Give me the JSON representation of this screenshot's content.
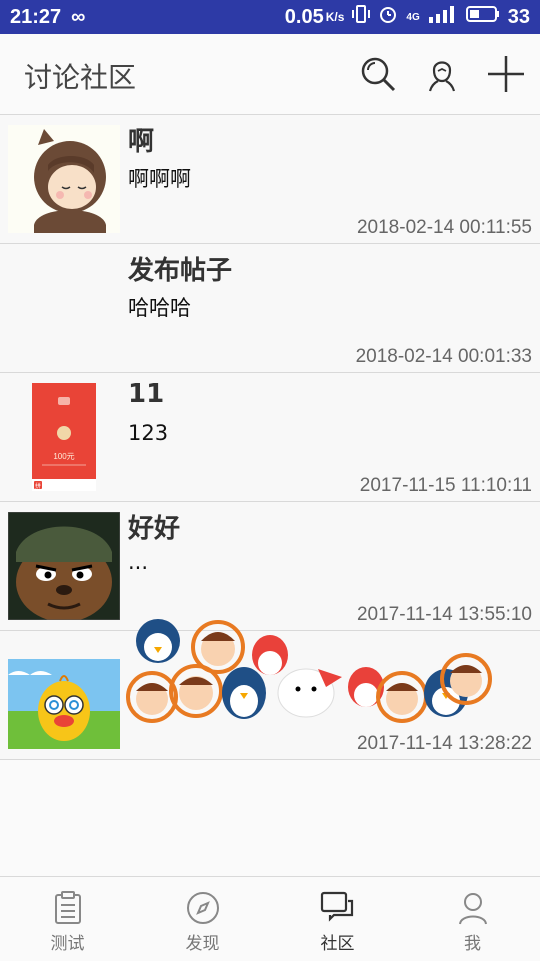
{
  "status_bar": {
    "time": "21:27",
    "infinity_icon": "∞",
    "speed": "0.05",
    "speed_unit": "K/s",
    "network": "4G",
    "battery": "33"
  },
  "header": {
    "title": "讨论社区",
    "icons": [
      "search-icon",
      "user-icon",
      "add-icon"
    ]
  },
  "posts": [
    {
      "title": "啊",
      "body": "啊啊啊",
      "time": "2018-02-14 00:11:55",
      "image": "cartoon-girl-avatar"
    },
    {
      "title": "发布帖子",
      "body": "哈哈哈",
      "time": "2018-02-14 00:01:33",
      "image": ""
    },
    {
      "title": "11",
      "body": "123",
      "time": "2017-11-15 11:10:11",
      "image": "red-envelope-image"
    },
    {
      "title": "好好",
      "body": "...",
      "time": "2017-11-14 13:55:10",
      "image": "cartoon-mouse-avatar"
    },
    {
      "title": "",
      "body": "",
      "time": "2017-11-14 13:28:22",
      "image": "yellow-duck-image"
    }
  ],
  "red_envelope": {
    "amount_label": "100元",
    "badge": "拼"
  },
  "bottom_nav": {
    "items": [
      {
        "label": "测试",
        "icon": "clipboard-icon"
      },
      {
        "label": "发现",
        "icon": "compass-icon"
      },
      {
        "label": "社区",
        "icon": "chat-icon"
      },
      {
        "label": "我",
        "icon": "person-icon"
      }
    ],
    "active_index": 2
  },
  "colors": {
    "status_bar": "#2d3aa6",
    "background": "#fafafa",
    "divider": "#d9d9d9",
    "title_text": "#444444",
    "time_text": "#666666"
  }
}
